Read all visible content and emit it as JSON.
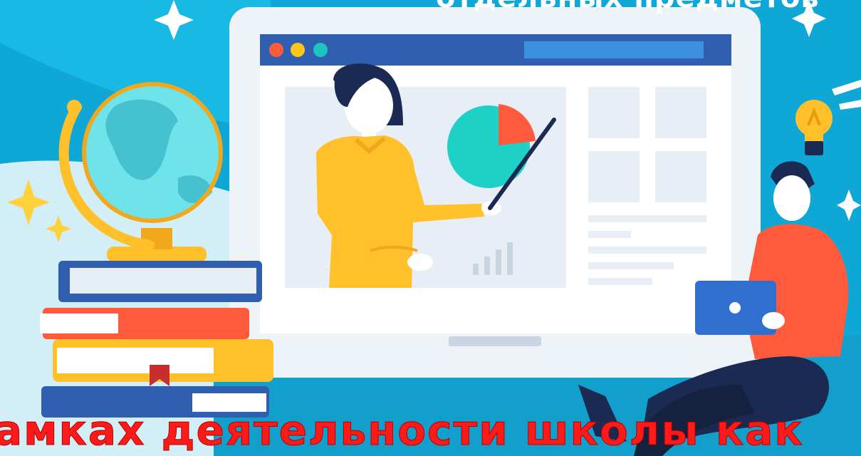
{
  "captions": {
    "top": "отдельных предметов",
    "bottom": "амках деятельности школы как"
  },
  "colors": {
    "background": "#0fa8d6",
    "monitor_frame": "#eef3f7",
    "browser_bar": "#2f5fae",
    "caption_bottom": "#ff1a1a",
    "caption_top": "#ffffff"
  },
  "icons": [
    "globe-icon",
    "books-icon",
    "lightbulb-icon",
    "laptop-icon",
    "pie-chart-icon",
    "bar-chart-icon",
    "sparkle-icon"
  ]
}
